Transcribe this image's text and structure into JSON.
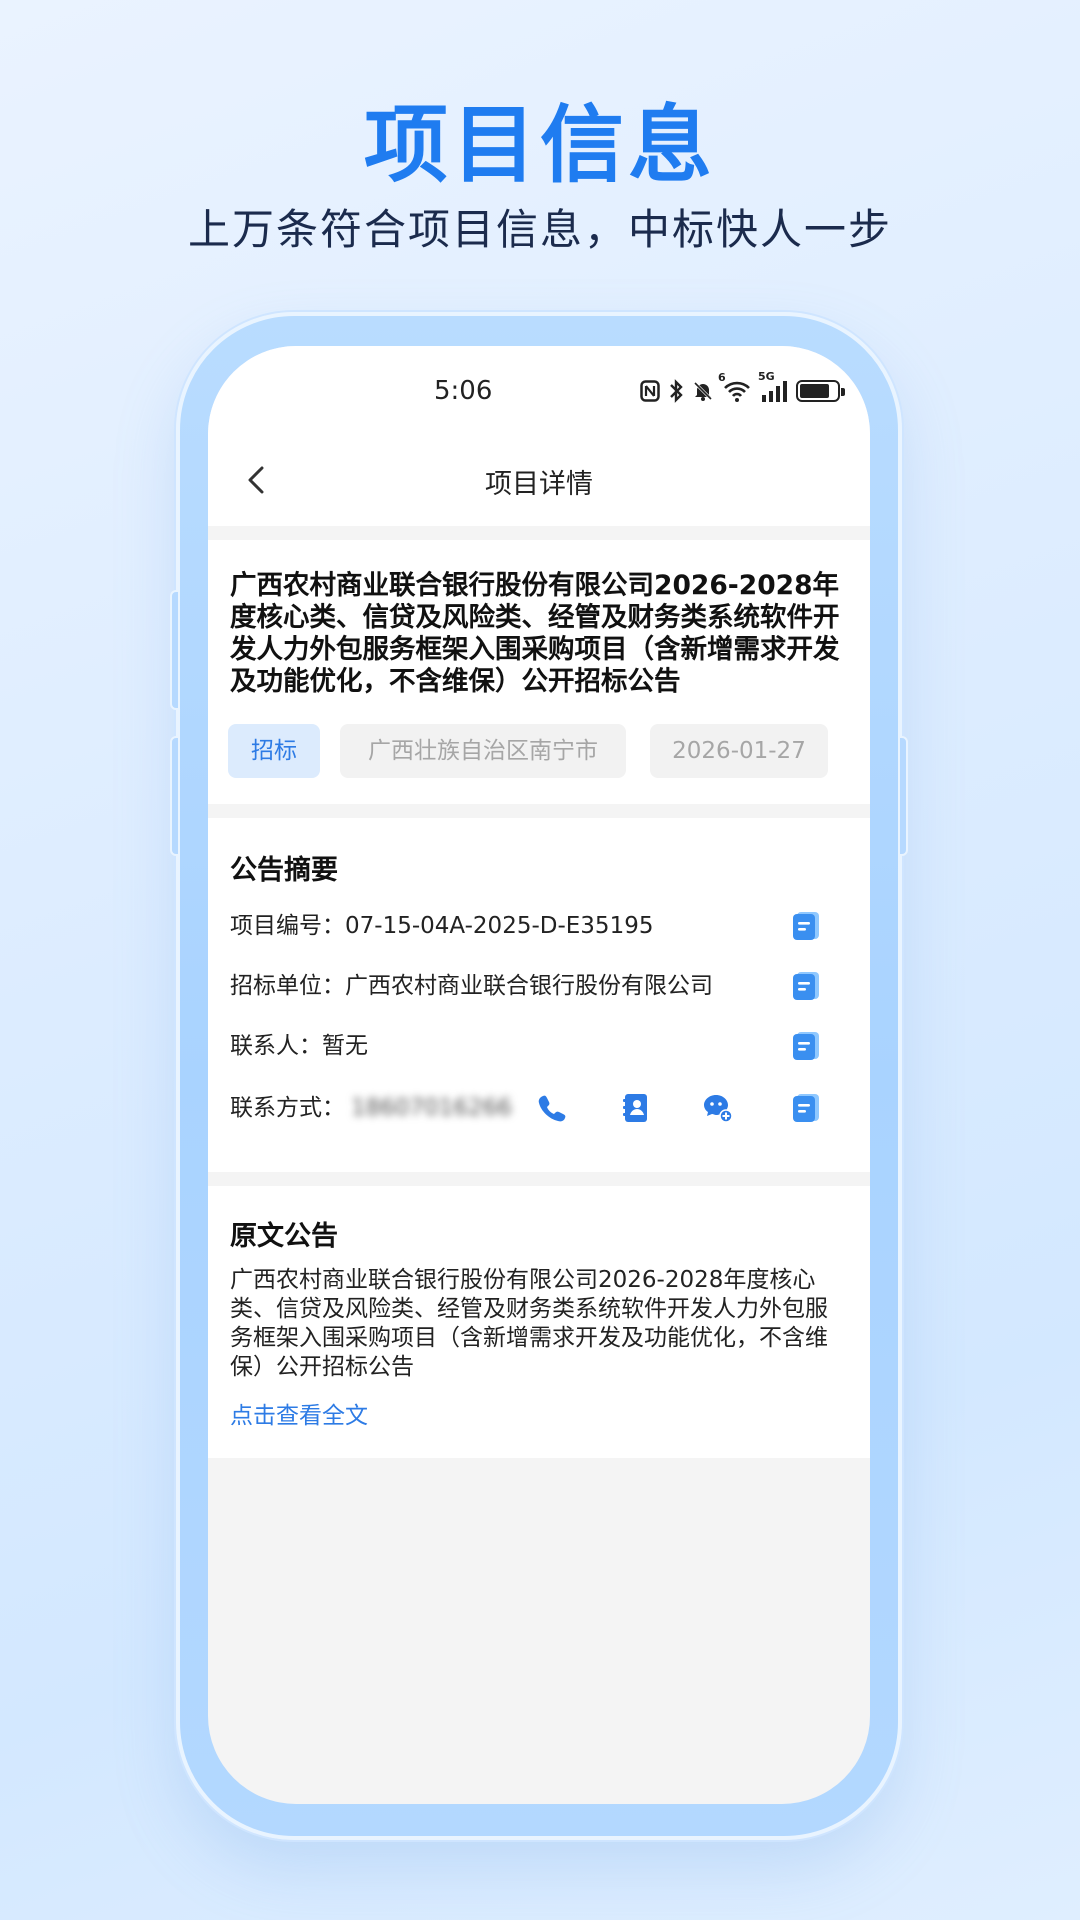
{
  "headline": "项目信息",
  "subline": "上万条符合项目信息，中标快人一步",
  "status_bar": {
    "time": "5:06",
    "icons": [
      "nfc-icon",
      "bluetooth-icon",
      "mute-bell-icon",
      "wifi-icon",
      "5g-signal-icon",
      "battery-icon"
    ],
    "wifi_badge": "6",
    "net_label": "5G"
  },
  "nav": {
    "title": "项目详情"
  },
  "project": {
    "title": "广西农村商业联合银行股份有限公司2026-2028年度核心类、信贷及风险类、经管及财务类系统软件开发人力外包服务框架入围采购项目（含新增需求开发及功能优化，不含维保）公开招标公告",
    "type_tag": "招标",
    "region_tag": "广西壮族自治区南宁市",
    "date_tag": "2026-01-27"
  },
  "summary": {
    "title": "公告摘要",
    "rows": [
      {
        "label": "项目编号：",
        "value": "07-15-04A-2025-D-E35195"
      },
      {
        "label": "招标单位：",
        "value": "广西农村商业联合银行股份有限公司"
      },
      {
        "label": "联系人：",
        "value": "暂无"
      },
      {
        "label": "联系方式：",
        "value": "18607016266"
      }
    ]
  },
  "original": {
    "title": "原文公告",
    "text": "广西农村商业联合银行股份有限公司2026-2028年度核心类、信贷及风险类、经管及财务类系统软件开发人力外包服务框架入围采购项目（含新增需求开发及功能优化，不含维保）公开招标公告",
    "link": "点击查看全文"
  },
  "colors": {
    "accent": "#2d7be5",
    "headline": "#1f7cf0"
  }
}
